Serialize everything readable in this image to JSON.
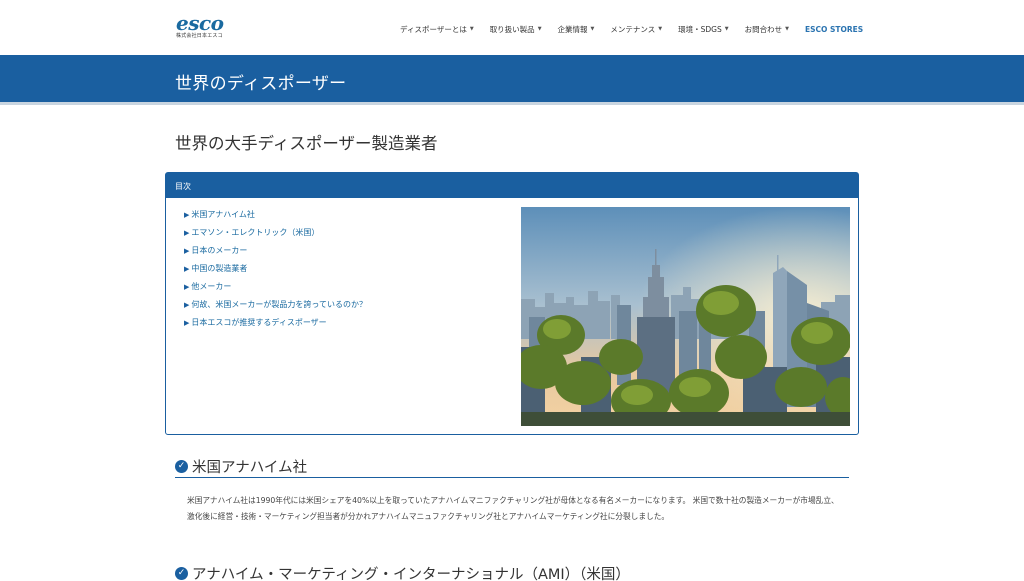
{
  "header": {
    "logo_text": "esco",
    "logo_sub": "株式会社日本エスコ",
    "nav": [
      {
        "label": "ディスポーザーとは",
        "has_caret": true
      },
      {
        "label": "取り扱い製品",
        "has_caret": true
      },
      {
        "label": "企業情報",
        "has_caret": true
      },
      {
        "label": "メンテナンス",
        "has_caret": true
      },
      {
        "label": "環境・SDGS",
        "has_caret": true
      },
      {
        "label": "お問合わせ",
        "has_caret": true
      },
      {
        "label": "ESCO STORES",
        "has_caret": false
      }
    ]
  },
  "banner": {
    "title": "世界のディスポーザー"
  },
  "page": {
    "title": "世界の大手ディスポーザー製造業者"
  },
  "toc": {
    "header": "目次",
    "items": [
      "米国アナハイム社",
      "エマソン・エレクトリック（米国）",
      "日本のメーカー",
      "中国の製造業者",
      "他メーカー",
      "何故、米国メーカーが製品力を誇っているのか？",
      "日本エスコが推奨するディスポーザー"
    ]
  },
  "sections": [
    {
      "heading": "米国アナハイム社",
      "body": "米国アナハイム社は1990年代には米国シェアを40%以上を取っていたアナハイムマニファクチャリング社が母体となる有名メーカーになります。 米国で数十社の製造メーカーが市場乱立、激化後に経営・技術・マーケティング担当者が分かれアナハイムマニュファクチャリング社とアナハイムマーケティング社に分裂しました。"
    },
    {
      "heading": "アナハイム・マーケティング・インターナショナル（AMI）（米国）"
    }
  ],
  "colors": {
    "brand": "#1a5fa0",
    "link": "#1a6aa0",
    "stores": "#2a73b0"
  },
  "icons": {
    "caret": "caret-down-icon",
    "toc_bullet": "triangle-right-icon",
    "section_check": "check-circle-icon"
  }
}
